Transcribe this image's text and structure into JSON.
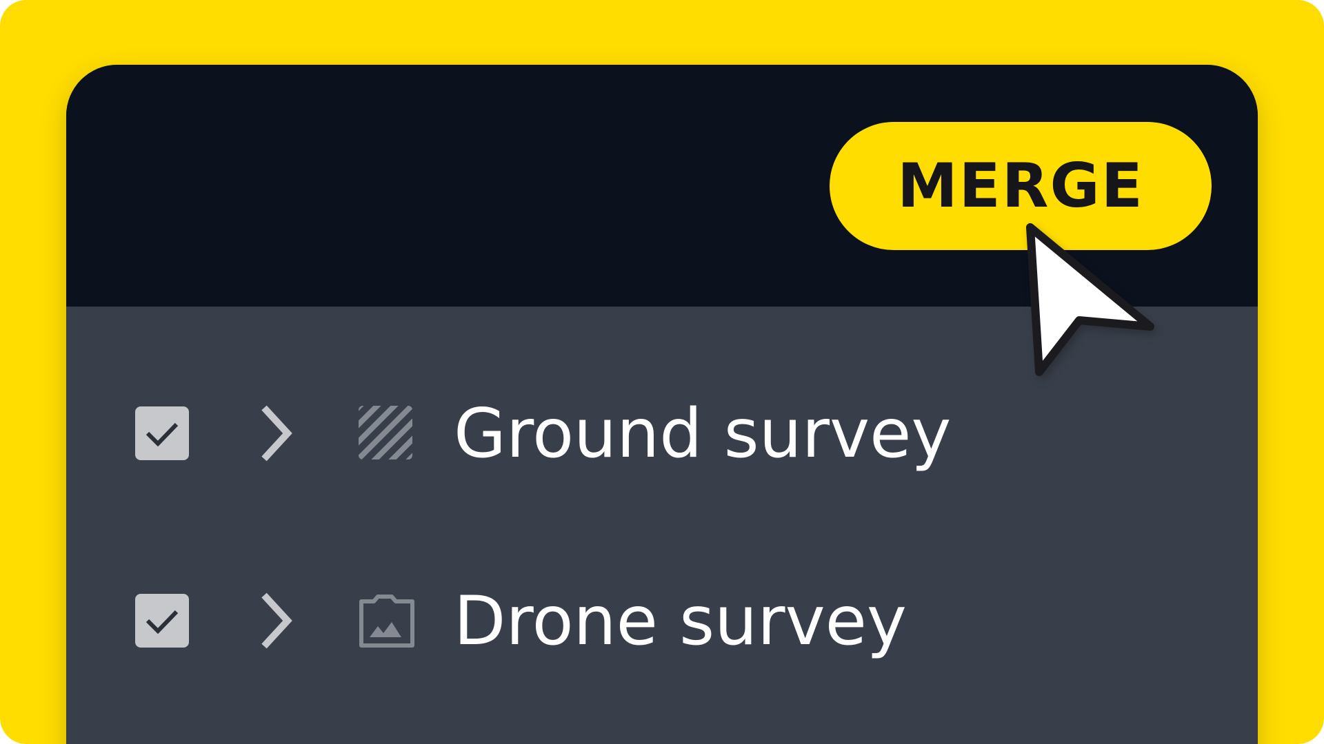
{
  "toolbar": {
    "merge_label": "MERGE"
  },
  "layers": [
    {
      "name": "Ground survey",
      "checked": true,
      "expanded": false,
      "type_icon": "hatched-layer-icon"
    },
    {
      "name": "Drone survey",
      "checked": true,
      "expanded": false,
      "type_icon": "image-layer-icon"
    }
  ],
  "colors": {
    "frame": "#FFDD00",
    "header": "#0B111D",
    "list_background": "#393F4A",
    "merge_button": "#FFDD00",
    "checkbox": "#C7C8CC",
    "text": "#FFFFFF"
  }
}
